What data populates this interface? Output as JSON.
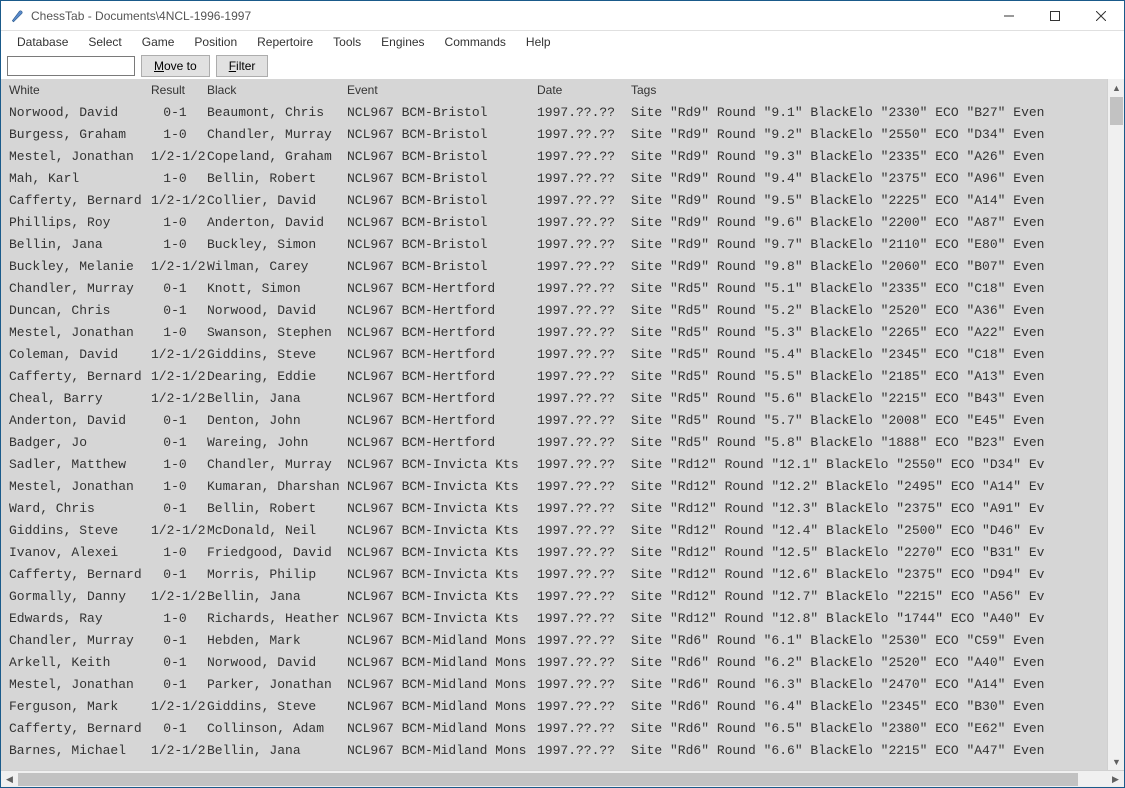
{
  "window": {
    "title": "ChessTab - Documents\\4NCL-1996-1997"
  },
  "menu": [
    "Database",
    "Select",
    "Game",
    "Position",
    "Repertoire",
    "Tools",
    "Engines",
    "Commands",
    "Help"
  ],
  "toolbar": {
    "filter_input": "",
    "move_to_label": "Move to",
    "filter_label": "Filter"
  },
  "columns": {
    "white": "White",
    "result": "Result",
    "black": "Black",
    "event": "Event",
    "date": "Date",
    "tags": "Tags"
  },
  "rows": [
    {
      "white": "Norwood, David",
      "result": "0-1",
      "black": "Beaumont, Chris",
      "event": "NCL967 BCM-Bristol",
      "date": "1997.??.??",
      "tags": "Site \"Rd9\"  Round \"9.1\"  BlackElo \"2330\"  ECO \"B27\"  Even"
    },
    {
      "white": "Burgess, Graham",
      "result": "1-0",
      "black": "Chandler, Murray",
      "event": "NCL967 BCM-Bristol",
      "date": "1997.??.??",
      "tags": "Site \"Rd9\"  Round \"9.2\"  BlackElo \"2550\"  ECO \"D34\"  Even"
    },
    {
      "white": "Mestel, Jonathan",
      "result": "1/2-1/2",
      "black": "Copeland, Graham",
      "event": "NCL967 BCM-Bristol",
      "date": "1997.??.??",
      "tags": "Site \"Rd9\"  Round \"9.3\"  BlackElo \"2335\"  ECO \"A26\"  Even"
    },
    {
      "white": "Mah, Karl",
      "result": "1-0",
      "black": "Bellin, Robert",
      "event": "NCL967 BCM-Bristol",
      "date": "1997.??.??",
      "tags": "Site \"Rd9\"  Round \"9.4\"  BlackElo \"2375\"  ECO \"A96\"  Even"
    },
    {
      "white": "Cafferty, Bernard",
      "result": "1/2-1/2",
      "black": "Collier, David",
      "event": "NCL967 BCM-Bristol",
      "date": "1997.??.??",
      "tags": "Site \"Rd9\"  Round \"9.5\"  BlackElo \"2225\"  ECO \"A14\"  Even"
    },
    {
      "white": "Phillips, Roy",
      "result": "1-0",
      "black": "Anderton, David",
      "event": "NCL967 BCM-Bristol",
      "date": "1997.??.??",
      "tags": "Site \"Rd9\"  Round \"9.6\"  BlackElo \"2200\"  ECO \"A87\"  Even"
    },
    {
      "white": "Bellin, Jana",
      "result": "1-0",
      "black": "Buckley, Simon",
      "event": "NCL967 BCM-Bristol",
      "date": "1997.??.??",
      "tags": "Site \"Rd9\"  Round \"9.7\"  BlackElo \"2110\"  ECO \"E80\"  Even"
    },
    {
      "white": "Buckley, Melanie",
      "result": "1/2-1/2",
      "black": "Wilman, Carey",
      "event": "NCL967 BCM-Bristol",
      "date": "1997.??.??",
      "tags": "Site \"Rd9\"  Round \"9.8\"  BlackElo \"2060\"  ECO \"B07\"  Even"
    },
    {
      "white": "Chandler, Murray",
      "result": "0-1",
      "black": "Knott, Simon",
      "event": "NCL967 BCM-Hertford",
      "date": "1997.??.??",
      "tags": "Site \"Rd5\"  Round \"5.1\"  BlackElo \"2335\"  ECO \"C18\"  Even"
    },
    {
      "white": "Duncan, Chris",
      "result": "0-1",
      "black": "Norwood, David",
      "event": "NCL967 BCM-Hertford",
      "date": "1997.??.??",
      "tags": "Site \"Rd5\"  Round \"5.2\"  BlackElo \"2520\"  ECO \"A36\"  Even"
    },
    {
      "white": "Mestel, Jonathan",
      "result": "1-0",
      "black": "Swanson, Stephen",
      "event": "NCL967 BCM-Hertford",
      "date": "1997.??.??",
      "tags": "Site \"Rd5\"  Round \"5.3\"  BlackElo \"2265\"  ECO \"A22\"  Even"
    },
    {
      "white": "Coleman, David",
      "result": "1/2-1/2",
      "black": "Giddins, Steve",
      "event": "NCL967 BCM-Hertford",
      "date": "1997.??.??",
      "tags": "Site \"Rd5\"  Round \"5.4\"  BlackElo \"2345\"  ECO \"C18\"  Even"
    },
    {
      "white": "Cafferty, Bernard",
      "result": "1/2-1/2",
      "black": "Dearing, Eddie",
      "event": "NCL967 BCM-Hertford",
      "date": "1997.??.??",
      "tags": "Site \"Rd5\"  Round \"5.5\"  BlackElo \"2185\"  ECO \"A13\"  Even"
    },
    {
      "white": "Cheal, Barry",
      "result": "1/2-1/2",
      "black": "Bellin, Jana",
      "event": "NCL967 BCM-Hertford",
      "date": "1997.??.??",
      "tags": "Site \"Rd5\"  Round \"5.6\"  BlackElo \"2215\"  ECO \"B43\"  Even"
    },
    {
      "white": "Anderton, David",
      "result": "0-1",
      "black": "Denton, John",
      "event": "NCL967 BCM-Hertford",
      "date": "1997.??.??",
      "tags": "Site \"Rd5\"  Round \"5.7\"  BlackElo \"2008\"  ECO \"E45\"  Even"
    },
    {
      "white": "Badger, Jo",
      "result": "0-1",
      "black": "Wareing, John",
      "event": "NCL967 BCM-Hertford",
      "date": "1997.??.??",
      "tags": "Site \"Rd5\"  Round \"5.8\"  BlackElo \"1888\"  ECO \"B23\"  Even"
    },
    {
      "white": "Sadler, Matthew",
      "result": "1-0",
      "black": "Chandler, Murray",
      "event": "NCL967 BCM-Invicta Kts",
      "date": "1997.??.??",
      "tags": "Site \"Rd12\"  Round \"12.1\"  BlackElo \"2550\"  ECO \"D34\"  Ev"
    },
    {
      "white": "Mestel, Jonathan",
      "result": "1-0",
      "black": "Kumaran, Dharshan",
      "event": "NCL967 BCM-Invicta Kts",
      "date": "1997.??.??",
      "tags": "Site \"Rd12\"  Round \"12.2\"  BlackElo \"2495\"  ECO \"A14\"  Ev"
    },
    {
      "white": "Ward, Chris",
      "result": "0-1",
      "black": "Bellin, Robert",
      "event": "NCL967 BCM-Invicta Kts",
      "date": "1997.??.??",
      "tags": "Site \"Rd12\"  Round \"12.3\"  BlackElo \"2375\"  ECO \"A91\"  Ev"
    },
    {
      "white": "Giddins, Steve",
      "result": "1/2-1/2",
      "black": "McDonald, Neil",
      "event": "NCL967 BCM-Invicta Kts",
      "date": "1997.??.??",
      "tags": "Site \"Rd12\"  Round \"12.4\"  BlackElo \"2500\"  ECO \"D46\"  Ev"
    },
    {
      "white": "Ivanov, Alexei",
      "result": "1-0",
      "black": "Friedgood, David",
      "event": "NCL967 BCM-Invicta Kts",
      "date": "1997.??.??",
      "tags": "Site \"Rd12\"  Round \"12.5\"  BlackElo \"2270\"  ECO \"B31\"  Ev"
    },
    {
      "white": "Cafferty, Bernard",
      "result": "0-1",
      "black": "Morris, Philip",
      "event": "NCL967 BCM-Invicta Kts",
      "date": "1997.??.??",
      "tags": "Site \"Rd12\"  Round \"12.6\"  BlackElo \"2375\"  ECO \"D94\"  Ev"
    },
    {
      "white": "Gormally, Danny",
      "result": "1/2-1/2",
      "black": "Bellin, Jana",
      "event": "NCL967 BCM-Invicta Kts",
      "date": "1997.??.??",
      "tags": "Site \"Rd12\"  Round \"12.7\"  BlackElo \"2215\"  ECO \"A56\"  Ev"
    },
    {
      "white": "Edwards, Ray",
      "result": "1-0",
      "black": "Richards, Heather",
      "event": "NCL967 BCM-Invicta Kts",
      "date": "1997.??.??",
      "tags": "Site \"Rd12\"  Round \"12.8\"  BlackElo \"1744\"  ECO \"A40\"  Ev"
    },
    {
      "white": "Chandler, Murray",
      "result": "0-1",
      "black": "Hebden, Mark",
      "event": "NCL967 BCM-Midland Mons",
      "date": "1997.??.??",
      "tags": "Site \"Rd6\"  Round \"6.1\"  BlackElo \"2530\"  ECO \"C59\"  Even"
    },
    {
      "white": "Arkell, Keith",
      "result": "0-1",
      "black": "Norwood, David",
      "event": "NCL967 BCM-Midland Mons",
      "date": "1997.??.??",
      "tags": "Site \"Rd6\"  Round \"6.2\"  BlackElo \"2520\"  ECO \"A40\"  Even"
    },
    {
      "white": "Mestel, Jonathan",
      "result": "0-1",
      "black": "Parker, Jonathan",
      "event": "NCL967 BCM-Midland Mons",
      "date": "1997.??.??",
      "tags": "Site \"Rd6\"  Round \"6.3\"  BlackElo \"2470\"  ECO \"A14\"  Even"
    },
    {
      "white": "Ferguson, Mark",
      "result": "1/2-1/2",
      "black": "Giddins, Steve",
      "event": "NCL967 BCM-Midland Mons",
      "date": "1997.??.??",
      "tags": "Site \"Rd6\"  Round \"6.4\"  BlackElo \"2345\"  ECO \"B30\"  Even"
    },
    {
      "white": "Cafferty, Bernard",
      "result": "0-1",
      "black": "Collinson, Adam",
      "event": "NCL967 BCM-Midland Mons",
      "date": "1997.??.??",
      "tags": "Site \"Rd6\"  Round \"6.5\"  BlackElo \"2380\"  ECO \"E62\"  Even"
    },
    {
      "white": "Barnes, Michael",
      "result": "1/2-1/2",
      "black": "Bellin, Jana",
      "event": "NCL967 BCM-Midland Mons",
      "date": "1997.??.??",
      "tags": "Site \"Rd6\"  Round \"6.6\"  BlackElo \"2215\"  ECO \"A47\"  Even"
    }
  ]
}
